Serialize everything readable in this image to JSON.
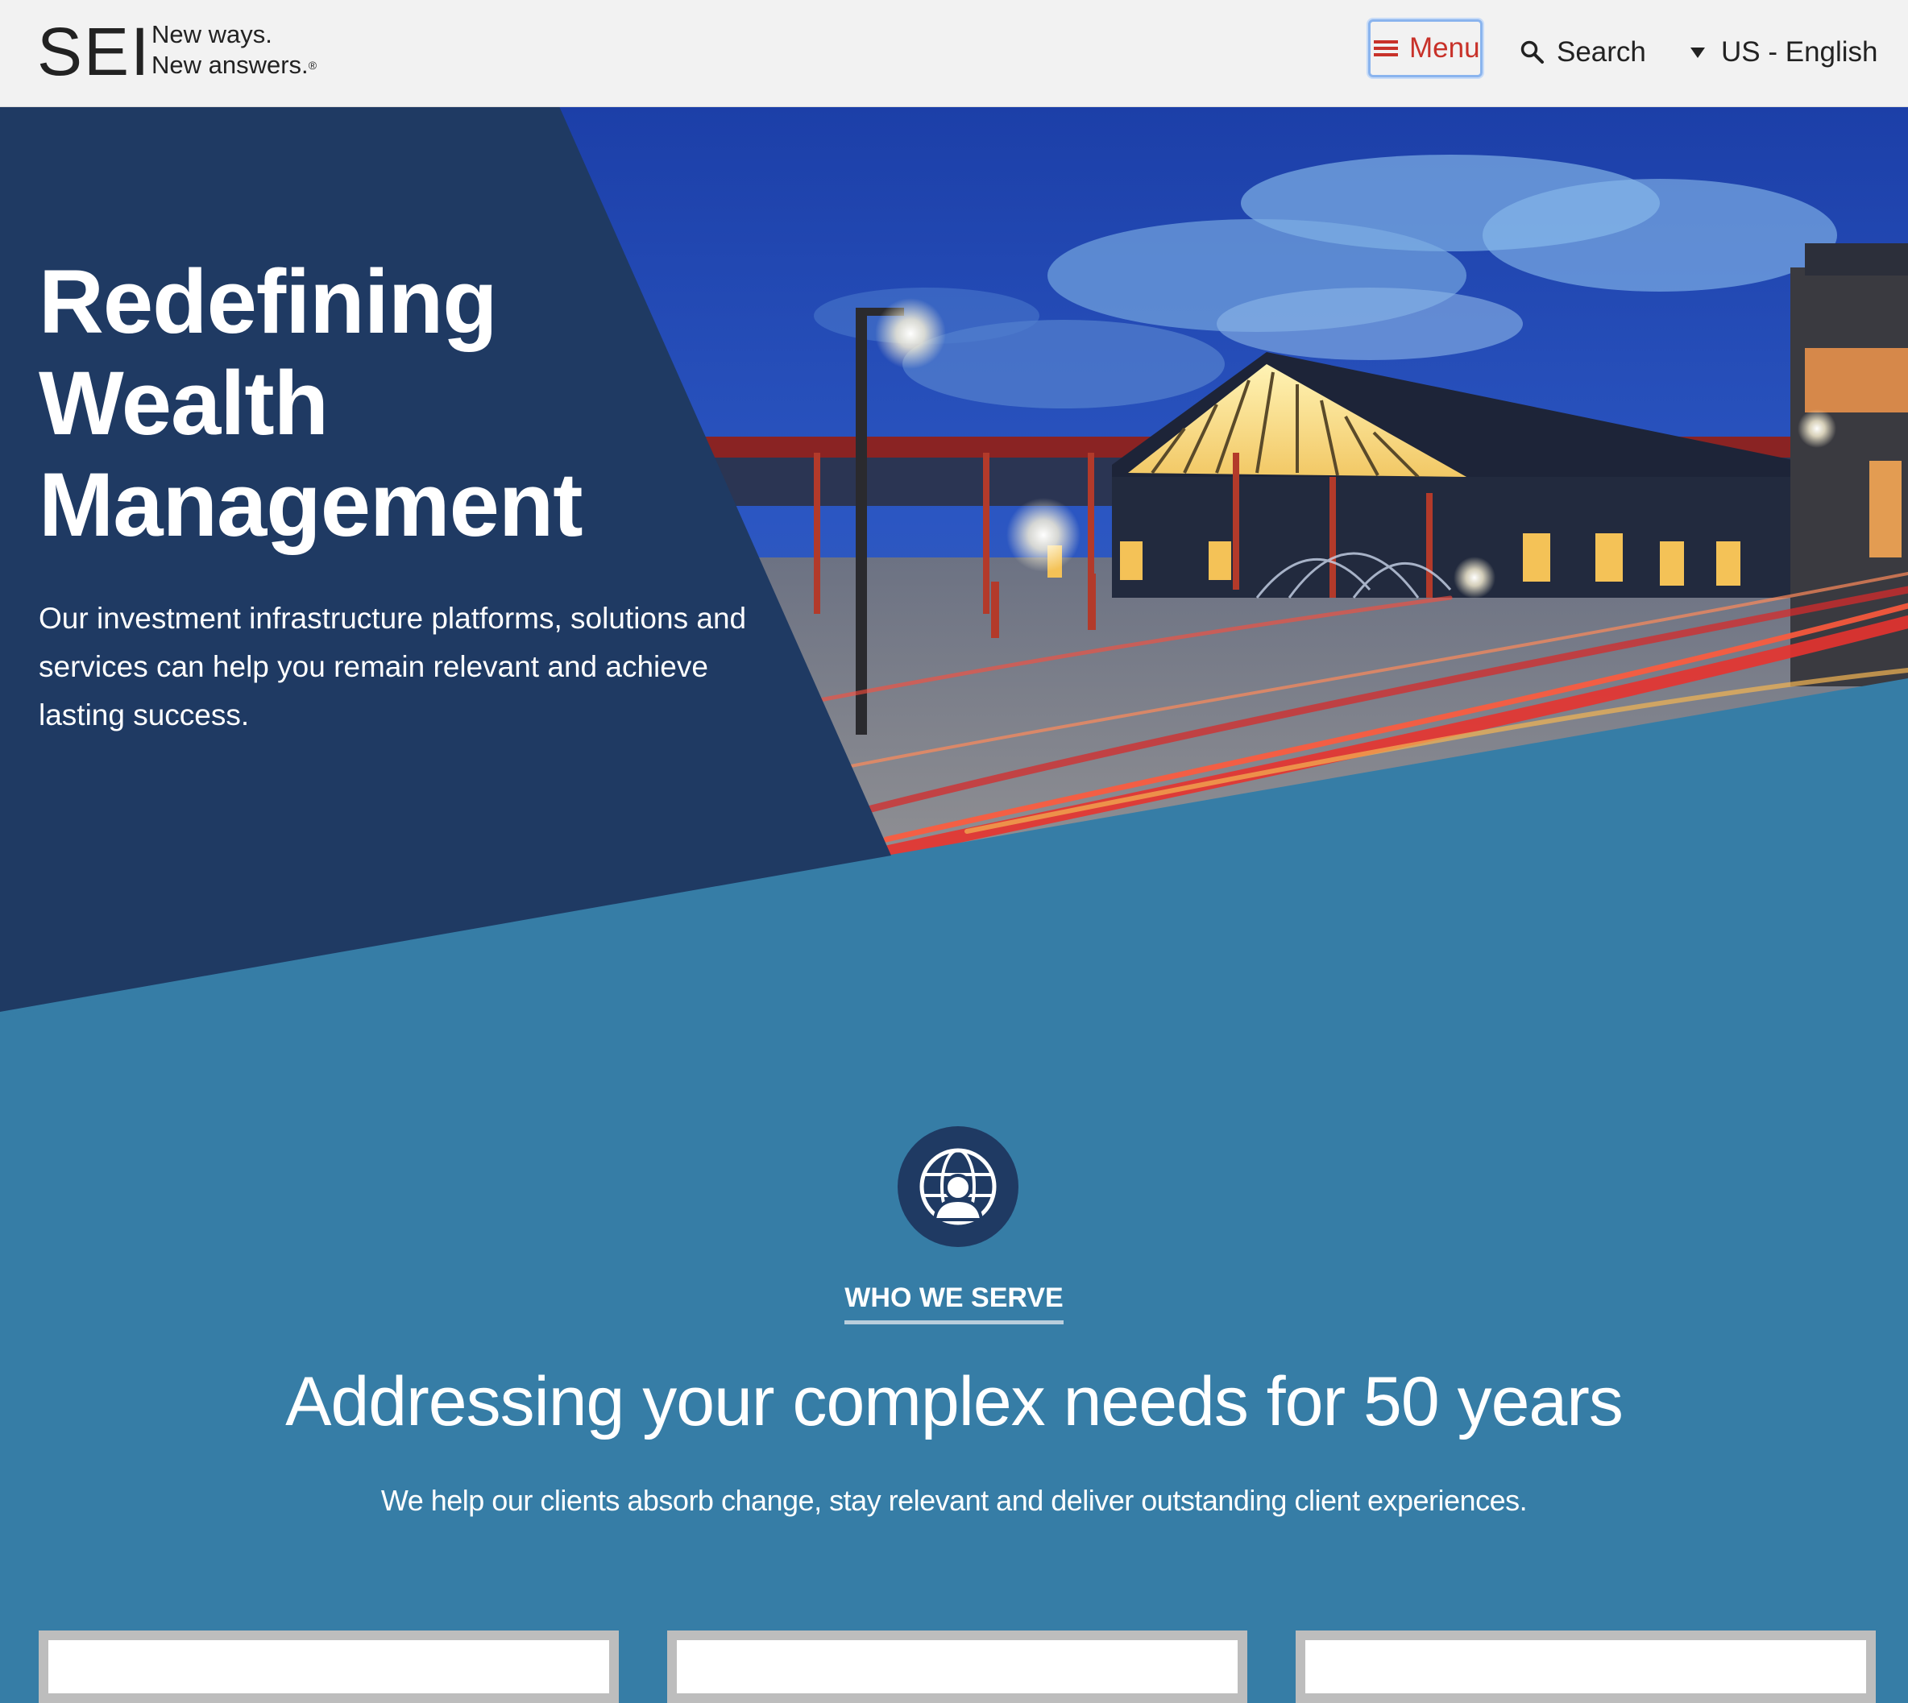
{
  "brand": {
    "logo": "SEI",
    "tagline_line1": "New ways.",
    "tagline_line2": "New answers.",
    "tagline_mark": "®"
  },
  "nav": {
    "menu_label": "Menu",
    "search_label": "Search",
    "language_label": "US - English",
    "menu_icon": "hamburger-icon",
    "search_icon": "magnifier-icon",
    "language_icon": "caret-down-icon"
  },
  "hero": {
    "title_line1": "Redefining",
    "title_line2": "Wealth",
    "title_line3": "Management",
    "text": "Our investment infrastructure platforms, solutions and services can help you remain relevant and achieve lasting success."
  },
  "serve": {
    "icon": "globe-person-icon",
    "eyebrow": "WHO WE SERVE",
    "heading": "Addressing your complex needs for 50 years",
    "subheading": "We help our clients absorb change, stay relevant and deliver outstanding client experiences."
  },
  "colors": {
    "header_bg": "#f2f2f2",
    "navy": "#1f3a63",
    "teal": "#367da6",
    "accent_red": "#c8322a"
  }
}
